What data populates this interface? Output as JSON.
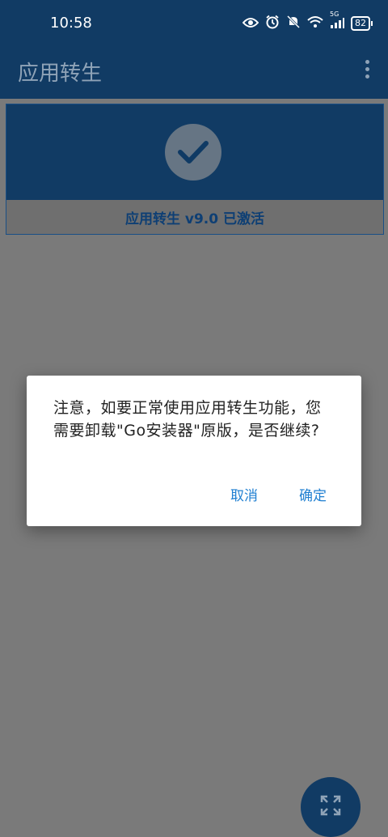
{
  "status_bar": {
    "time": "10:58",
    "network": "5G",
    "battery": "82",
    "icons": [
      "eye-icon",
      "alarm-icon",
      "mute-bell-icon",
      "wifi-icon",
      "signal-icon",
      "battery-icon"
    ]
  },
  "app_bar": {
    "title": "应用转生",
    "menu_icon": "more-vert-icon"
  },
  "status_card": {
    "icon": "check-circle-icon",
    "text": "应用转生 v9.0 已激活"
  },
  "dialog": {
    "message": "注意，如要正常使用应用转生功能，您需要卸载\"Go安装器\"原版，是否继续?",
    "cancel_label": "取消",
    "ok_label": "确定"
  },
  "fab": {
    "icon": "fullscreen-icon"
  },
  "colors": {
    "primary": "#113b64",
    "accent": "#1f7fd1",
    "scrim": "#7a7a7a",
    "dialog_bg": "#ffffff"
  }
}
